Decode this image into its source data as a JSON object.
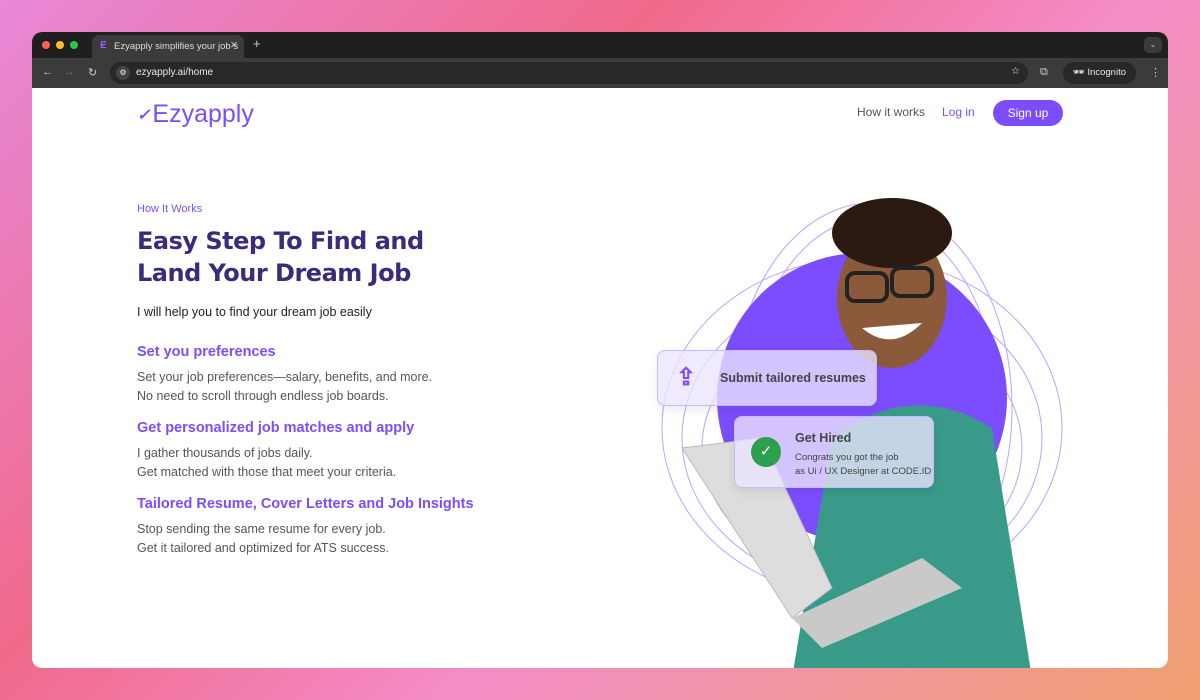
{
  "browser": {
    "tab_title": "Ezyapply simplifies your job s",
    "url": "ezyapply.ai/home",
    "incognito": "Incognito"
  },
  "nav": {
    "logo": "Ezyapply",
    "how": "How it works",
    "login": "Log in",
    "signup": "Sign up"
  },
  "hero": {
    "eyebrow": "How It Works",
    "title": "Easy Step To Find and Land Your Dream Job",
    "subtitle": "I will help you to find your dream job easily",
    "steps": [
      {
        "title": "Set you preferences",
        "l1": "Set your job preferences—salary, benefits, and more.",
        "l2": "No need to scroll through endless job boards."
      },
      {
        "title": "Get personalized job matches and apply",
        "l1": "I gather thousands of jobs daily.",
        "l2": "Get matched with those that meet your criteria."
      },
      {
        "title": "Tailored Resume, Cover Letters and Job Insights",
        "l1": "Stop sending the same resume for every job.",
        "l2": "Get it tailored and optimized for ATS success."
      }
    ]
  },
  "cards": {
    "submit": "Submit tailored resumes",
    "hired_title": "Get Hired",
    "hired_l1": "Congrats you got the job",
    "hired_l2": "as Ui / UX Designer at CODE.ID"
  },
  "colors": {
    "accent": "#7c4dff",
    "heading": "#3d2a7a",
    "success": "#2e9e4f"
  }
}
